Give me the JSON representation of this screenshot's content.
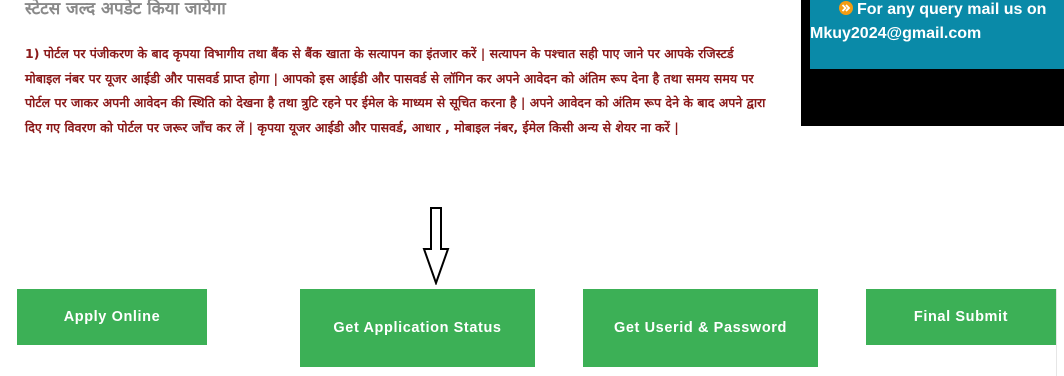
{
  "heading": "स्टेटस जल्द अपडेट किया जायेगा",
  "notice": "1) पोर्टल पर पंजीकरण के बाद कृपया विभागीय तथा बैंक से बैंक खाता के सत्यापन का इंतजार करें | सत्यापन के पश्चात सही पाए जाने पर आपके रजिस्टर्ड मोबाइल नंबर पर यूजर आईडी और पासवर्ड प्राप्त होगा | आपको इस आईडी और पासवर्ड से लॉगिन कर अपने आवेदन को अंतिम रूप देना है तथा समय समय पर पोर्टल पर जाकर अपनी आवेदन की स्थिति को देखना है तथा त्रुटि रहने पर ईमेल के माध्यम से सूचित करना है | अपने आवेदन को अंतिम रूप देने के बाद अपने द्वारा दिए गए विवरण को पोर्टल पर जरूर जाँच कर लें | कृपया यूजर आईडी और पासवर्ड, आधार , मोबाइल नंबर, ईमेल किसी अन्य से शेयर ना करें |",
  "side_panel": {
    "query_line": "For any query mail us on",
    "email": "Mkuy2024@gmail.com",
    "icon": "double-chevron-right-icon"
  },
  "arrow_icon": "down-arrow-icon",
  "buttons": {
    "apply_online": "Apply Online",
    "get_application_status": "Get Application Status",
    "get_userid_password": "Get Userid & Password",
    "final_submit": "Final Submit"
  },
  "colors": {
    "button_green": "#3cb056",
    "notice_red": "#8b1a1a",
    "heading_gray": "#8a8a8a",
    "panel_blue": "#0a8aa8",
    "panel_black": "#000000",
    "icon_orange": "#f39c12"
  }
}
